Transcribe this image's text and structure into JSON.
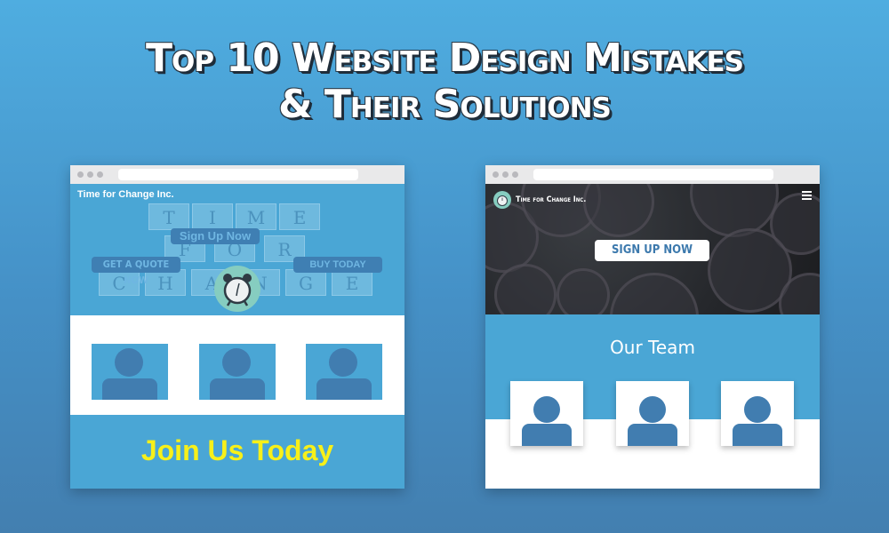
{
  "headline": {
    "line1": "Top 10 Website Design Mistakes",
    "line2": "& Their Solutions"
  },
  "colors": {
    "background_top": "#4fade0",
    "background_bottom": "#437fb0",
    "panel_blue": "#4aa6d5",
    "avatar_blue": "#417db0",
    "join_text_yellow": "#f7f019",
    "clock_teal": "#86cdc0"
  },
  "mistake_example": {
    "brand": "Time for Change Inc.",
    "hero_tiles": [
      "T",
      "I",
      "M",
      "E",
      "F",
      "O",
      "R",
      "C",
      "H",
      "A",
      "N",
      "G",
      "E"
    ],
    "buttons": {
      "signup": "Sign Up Now",
      "quote": "GET A QUOTE NOW",
      "buy": "BUY TODAY"
    },
    "clock_icon": "alarm-clock-icon",
    "avatars": [
      "person-icon",
      "person-icon",
      "person-icon"
    ],
    "cta": "Join Us Today"
  },
  "solution_example": {
    "brand": "Time for Change Inc.",
    "logo_icon": "alarm-clock-icon",
    "menu_icon": "hamburger-menu-icon",
    "signup_button": "SIGN UP NOW",
    "team_title": "Our Team",
    "avatars": [
      "person-icon",
      "person-icon",
      "person-icon"
    ]
  }
}
